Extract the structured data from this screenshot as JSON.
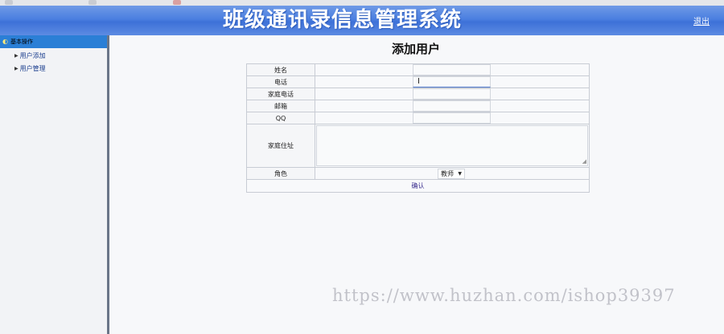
{
  "header": {
    "title": "班级通讯录信息管理系统",
    "logout_label": "退出"
  },
  "sidebar": {
    "group_label": "基本操作",
    "items": [
      {
        "label": "用户添加"
      },
      {
        "label": "用户管理"
      }
    ]
  },
  "main": {
    "page_title": "添加用户",
    "form": {
      "fields": [
        {
          "label": "姓名",
          "value": ""
        },
        {
          "label": "电话",
          "value": ""
        },
        {
          "label": "家庭电话",
          "value": ""
        },
        {
          "label": "邮箱",
          "value": ""
        },
        {
          "label": "QQ",
          "value": ""
        }
      ],
      "address_label": "家庭住址",
      "address_value": "",
      "role_label": "角色",
      "role_selected": "教师",
      "submit_label": "确认"
    }
  },
  "watermark": "https://www.huzhan.com/ishop39397",
  "colors": {
    "header_blue": "#4b7fe0",
    "sidebar_head": "#2b7fd6",
    "sidebar_border": "#6a7588"
  },
  "icons": [
    "eye-icon",
    "triangle-right-icon",
    "text-cursor-icon",
    "chevron-down-icon",
    "resize-grip-icon"
  ]
}
